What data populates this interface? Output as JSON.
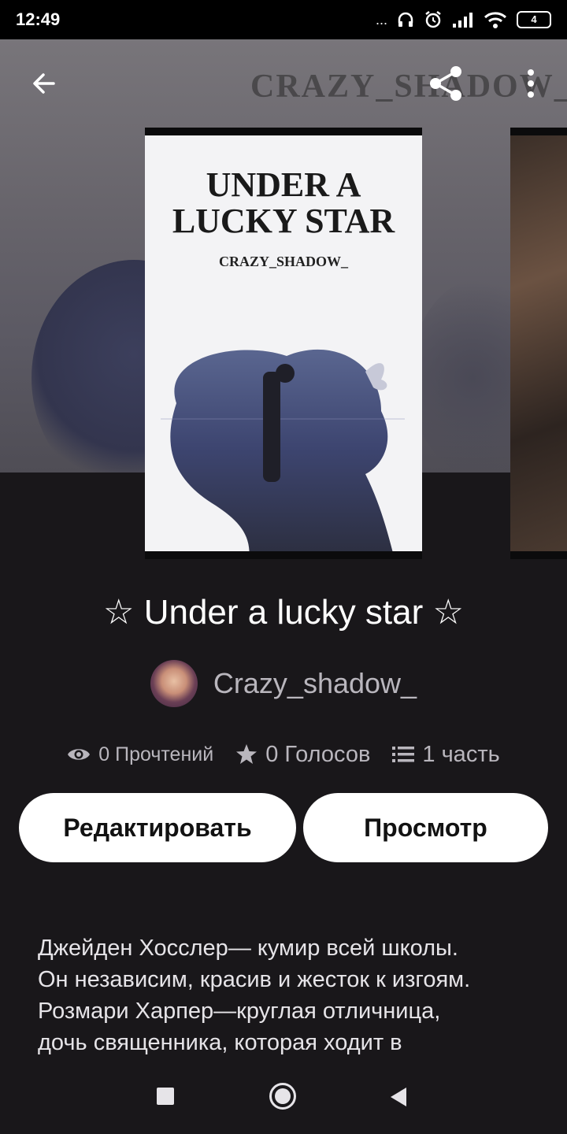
{
  "status_bar": {
    "time": "12:49",
    "dots": "...",
    "battery": "4"
  },
  "header": {
    "back_icon": "arrow-left-icon",
    "share_icon": "share-icon",
    "more_icon": "more-vertical-icon",
    "background_text": "CRAZY_SHADOW_"
  },
  "cover": {
    "title_line1": "UNDER A",
    "title_line2": "LUCKY STAR",
    "author": "CRAZY_SHADOW_"
  },
  "story": {
    "title": "☆ Under a lucky star ☆",
    "author": "Crazy_shadow_"
  },
  "stats": {
    "reads": "0 Прочтений",
    "votes": "0 Голосов",
    "parts": "1 часть"
  },
  "buttons": {
    "edit": "Редактировать",
    "preview": "Просмотр"
  },
  "description": {
    "line1": "Джейден Хосслер— кумир всей школы.",
    "line2": "Он независим, красив и жесток к изгоям.",
    "line3": "Розмари Харпер—круглая отличница,",
    "line4": "дочь священника, которая ходит в"
  },
  "colors": {
    "background": "#19171a",
    "button_bg": "#ffffff",
    "muted_text": "#b9b6bd"
  }
}
